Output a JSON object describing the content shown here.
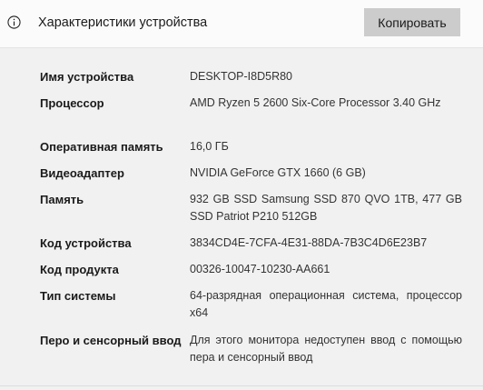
{
  "header": {
    "title": "Характеристики устройства",
    "copy_label": "Копировать",
    "info_icon": "info-circle-icon"
  },
  "specs": {
    "device_name": {
      "label": "Имя устройства",
      "value": "DESKTOP-I8D5R80"
    },
    "processor": {
      "label": "Процессор",
      "value": "AMD Ryzen 5 2600 Six-Core Processor 3.40 GHz"
    },
    "ram": {
      "label": "Оперативная память",
      "value": "16,0 ГБ"
    },
    "video_adapter": {
      "label": "Видеоадаптер",
      "value": "NVIDIA GeForce GTX 1660 (6 GB)"
    },
    "storage": {
      "label": "Память",
      "value": "932 GB SSD Samsung SSD 870 QVO 1TB, 477 GB SSD Patriot P210 512GB"
    },
    "device_id": {
      "label": "Код устройства",
      "value": "3834CD4E-7CFA-4E31-88DA-7B3C4D6E23B7"
    },
    "product_id": {
      "label": "Код продукта",
      "value": "00326-10047-10230-AA661"
    },
    "system_type": {
      "label": "Тип системы",
      "value": "64-разрядная операционная система, процессор x64"
    },
    "pen_touch": {
      "label": "Перо и сенсорный ввод",
      "value": "Для этого монитора недоступен ввод с помощью пера и сенсорный ввод"
    }
  }
}
